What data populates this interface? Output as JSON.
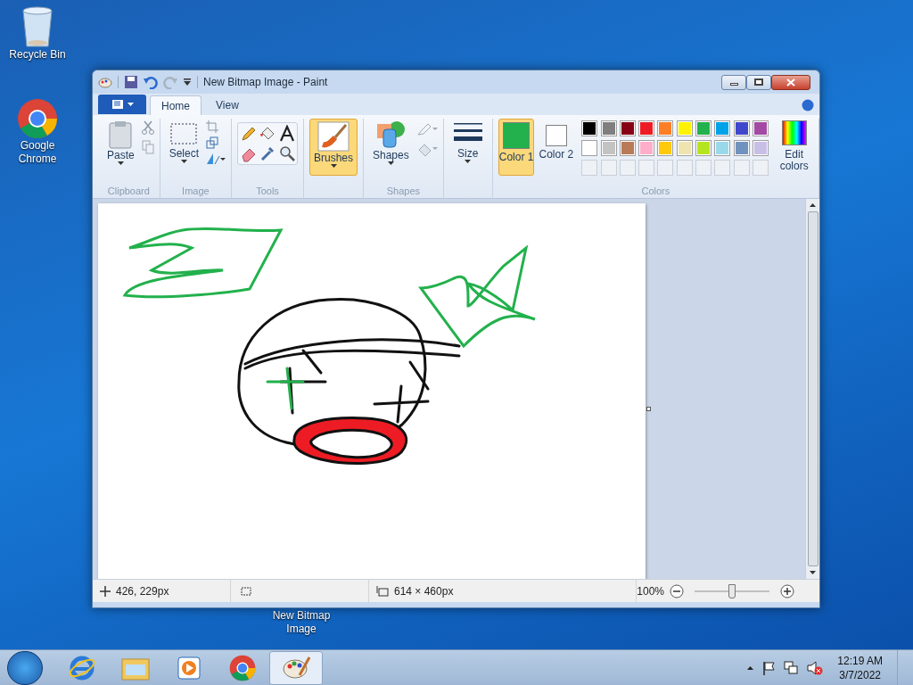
{
  "desktop_icons": [
    {
      "label": "Recycle Bin",
      "kind": "recycle"
    },
    {
      "label": "Google Chrome",
      "kind": "chrome"
    },
    {
      "label": "New Bitmap Image",
      "kind": "bitmap"
    }
  ],
  "window": {
    "title": "New Bitmap Image - Paint"
  },
  "ribbon": {
    "tabs": [
      {
        "label": "Home",
        "selected": true
      },
      {
        "label": "View",
        "selected": false
      }
    ],
    "groups": [
      {
        "kind": "clipboard",
        "label": "Clipboard",
        "button": "Paste"
      },
      {
        "kind": "image",
        "label": "Image",
        "button": "Select"
      },
      {
        "kind": "tools",
        "label": "Tools"
      },
      {
        "kind": "brushes",
        "button": "Brushes",
        "selected": true
      },
      {
        "kind": "shapes",
        "label": "Shapes",
        "button": "Shapes"
      },
      {
        "kind": "size",
        "button": "Size"
      },
      {
        "kind": "colors",
        "label": "Colors",
        "slots": [
          {
            "label": "Color 1",
            "color": "#22b14c",
            "selected": true
          },
          {
            "label": "Color 2",
            "color": "#ffffff",
            "selected": false
          }
        ],
        "palette": [
          {
            "color": "#000000"
          },
          {
            "color": "#7f7f7f"
          },
          {
            "color": "#880015"
          },
          {
            "color": "#ed1c24"
          },
          {
            "color": "#ff7f27"
          },
          {
            "color": "#fff200"
          },
          {
            "color": "#22b14c"
          },
          {
            "color": "#00a2e8"
          },
          {
            "color": "#3f48cc"
          },
          {
            "color": "#a349a4"
          },
          {
            "color": "#ffffff"
          },
          {
            "color": "#c3c3c3"
          },
          {
            "color": "#b97a57"
          },
          {
            "color": "#ffaec9"
          },
          {
            "color": "#ffc90e"
          },
          {
            "color": "#efe4b0"
          },
          {
            "color": "#b5e61d"
          },
          {
            "color": "#99d9ea"
          },
          {
            "color": "#7092be"
          },
          {
            "color": "#c8bfe7"
          }
        ],
        "edit": "Edit colors"
      }
    ]
  },
  "status_bar": {
    "position": "426, 229px",
    "size": "614 × 460px",
    "zoom": "100%",
    "level": 0.5
  },
  "taskbar": {
    "items": [
      {
        "kind": "ie",
        "selected": false
      },
      {
        "kind": "explorer",
        "selected": false
      },
      {
        "kind": "media",
        "selected": false
      },
      {
        "kind": "chrome",
        "selected": false
      },
      {
        "kind": "paint",
        "selected": true
      }
    ],
    "time": "12:19 AM",
    "date": "3/7/2022"
  }
}
